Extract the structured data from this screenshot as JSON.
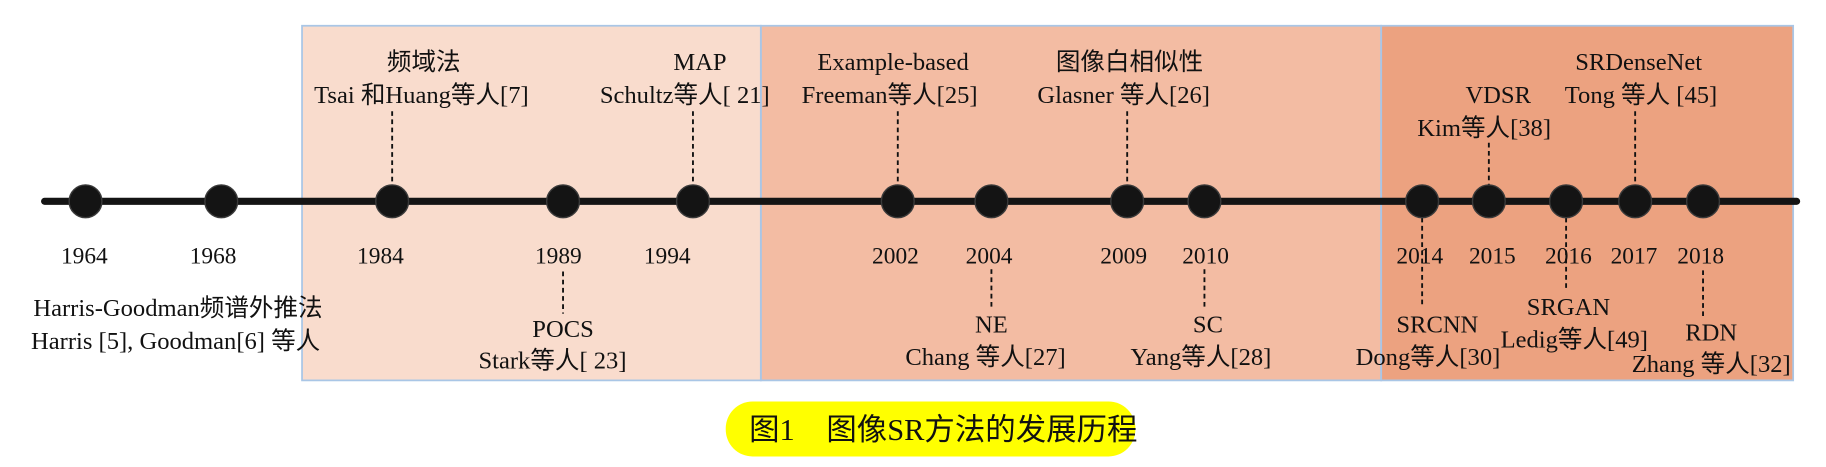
{
  "events": [
    {
      "year": "1964",
      "method": "Harris-Goodman频谱外推法",
      "authors": "Harris [5], Goodman[6] 等人"
    },
    {
      "year": "1968"
    },
    {
      "year": "1984",
      "method": "频域法",
      "authors": "Tsai 和Huang等人[7]"
    },
    {
      "year": "1989",
      "method": "POCS",
      "authors": "Stark等人[ 23]"
    },
    {
      "year": "1994",
      "method": "MAP",
      "authors": "Schultz等人[ 21]"
    },
    {
      "year": "2002",
      "method": "Example-based",
      "authors": "Freeman等人[25]"
    },
    {
      "year": "2004",
      "method": "NE",
      "authors": "Chang 等人[27]"
    },
    {
      "year": "2009",
      "method": "图像白相似性",
      "authors": "Glasner 等人[26]"
    },
    {
      "year": "2010",
      "method": "SC",
      "authors": "Yang等人[28]"
    },
    {
      "year": "2014",
      "method": "SRCNN",
      "authors": "Dong等人[30]"
    },
    {
      "year": "2015",
      "method": "VDSR",
      "authors": "Kim等人[38]"
    },
    {
      "year": "2016",
      "method": "SRGAN",
      "authors": "Ledig等人[49]"
    },
    {
      "year": "2017",
      "method": "SRDenseNet",
      "authors": "Tong 等人 [45]"
    },
    {
      "year": "2018",
      "method": "RDN",
      "authors": "Zhang 等人[32]"
    }
  ],
  "caption": {
    "figure_number": "图1",
    "title": "图像SR方法的发展历程"
  },
  "colors": {
    "era_early": "#f9dccd",
    "era_middle": "#f3bca3",
    "era_deep": "#eca280",
    "frame": "#a9c6e6",
    "timeline": "#141414",
    "caption_highlight": "#ffff00"
  }
}
